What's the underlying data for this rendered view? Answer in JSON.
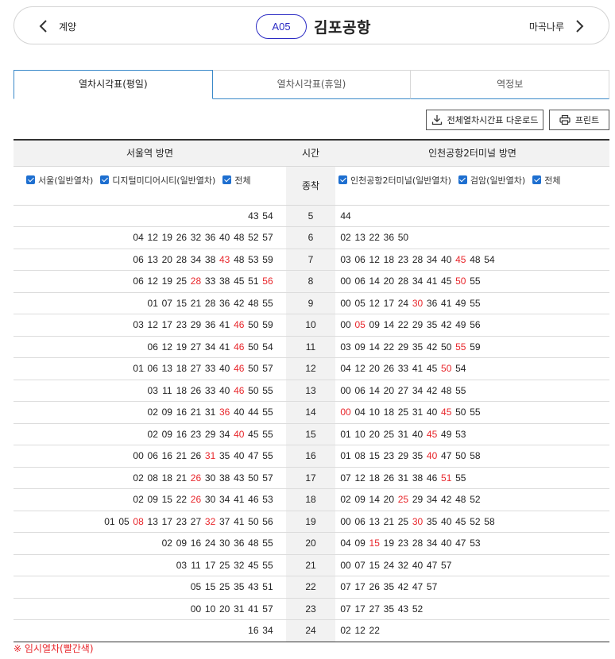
{
  "station": {
    "prev_label": "계양",
    "code": "A05",
    "name": "김포공항",
    "next_label": "마곡나루"
  },
  "tabs": [
    {
      "label": "열차시각표(평일)",
      "active": true
    },
    {
      "label": "열차시각표(휴일)",
      "active": false
    },
    {
      "label": "역정보",
      "active": false
    }
  ],
  "actions": {
    "download_label": "전체열차시간표 다운로드",
    "print_label": "프린트"
  },
  "timetable": {
    "header_left": "서울역 방면",
    "header_time": "시간",
    "header_right": "인천공항2터미널 방면",
    "terminal_label": "종착",
    "filters_left": [
      "서울(일반열차)",
      "디지털미디어시티(일반열차)",
      "전체"
    ],
    "filters_right": [
      "인천공항2터미널(일반열차)",
      "검암(일반열차)",
      "전체"
    ],
    "rows": [
      {
        "hour": "5",
        "left": [
          "43",
          "54"
        ],
        "right": [
          "44"
        ]
      },
      {
        "hour": "6",
        "left": [
          "04",
          "12",
          "19",
          "26",
          "32",
          "36",
          "40",
          "48",
          "52",
          "57"
        ],
        "right": [
          "02",
          "13",
          "22",
          "36",
          "50"
        ]
      },
      {
        "hour": "7",
        "left": [
          "06",
          "13",
          "20",
          "28",
          "34",
          "38",
          "*43",
          "48",
          "53",
          "59"
        ],
        "right": [
          "03",
          "06",
          "12",
          "18",
          "23",
          "28",
          "34",
          "40",
          "*45",
          "48",
          "54"
        ]
      },
      {
        "hour": "8",
        "left": [
          "06",
          "12",
          "19",
          "25",
          "*28",
          "33",
          "38",
          "45",
          "51",
          "*56"
        ],
        "right": [
          "00",
          "06",
          "14",
          "20",
          "28",
          "34",
          "41",
          "45",
          "*50",
          "55"
        ]
      },
      {
        "hour": "9",
        "left": [
          "01",
          "07",
          "15",
          "21",
          "28",
          "36",
          "42",
          "48",
          "55"
        ],
        "right": [
          "00",
          "05",
          "12",
          "17",
          "24",
          "*30",
          "36",
          "41",
          "49",
          "55"
        ]
      },
      {
        "hour": "10",
        "left": [
          "03",
          "12",
          "17",
          "23",
          "29",
          "36",
          "41",
          "*46",
          "50",
          "59"
        ],
        "right": [
          "00",
          "*05",
          "09",
          "14",
          "22",
          "29",
          "35",
          "42",
          "49",
          "56"
        ]
      },
      {
        "hour": "11",
        "left": [
          "06",
          "12",
          "19",
          "27",
          "34",
          "41",
          "*46",
          "50",
          "54"
        ],
        "right": [
          "03",
          "09",
          "14",
          "22",
          "29",
          "35",
          "42",
          "50",
          "*55",
          "59"
        ]
      },
      {
        "hour": "12",
        "left": [
          "01",
          "06",
          "13",
          "18",
          "27",
          "33",
          "40",
          "*46",
          "50",
          "57"
        ],
        "right": [
          "04",
          "12",
          "20",
          "26",
          "33",
          "41",
          "45",
          "*50",
          "54"
        ]
      },
      {
        "hour": "13",
        "left": [
          "03",
          "11",
          "18",
          "26",
          "33",
          "40",
          "*46",
          "50",
          "55"
        ],
        "right": [
          "00",
          "06",
          "14",
          "20",
          "27",
          "34",
          "42",
          "48",
          "55"
        ]
      },
      {
        "hour": "14",
        "left": [
          "02",
          "09",
          "16",
          "21",
          "31",
          "*36",
          "40",
          "44",
          "55"
        ],
        "right": [
          "*00",
          "04",
          "10",
          "18",
          "25",
          "31",
          "40",
          "*45",
          "50",
          "55"
        ]
      },
      {
        "hour": "15",
        "left": [
          "02",
          "09",
          "16",
          "23",
          "29",
          "34",
          "*40",
          "45",
          "55"
        ],
        "right": [
          "01",
          "10",
          "20",
          "25",
          "31",
          "40",
          "*45",
          "49",
          "53"
        ]
      },
      {
        "hour": "16",
        "left": [
          "00",
          "06",
          "16",
          "21",
          "26",
          "*31",
          "35",
          "40",
          "47",
          "55"
        ],
        "right": [
          "01",
          "08",
          "15",
          "23",
          "29",
          "35",
          "*40",
          "47",
          "50",
          "58"
        ]
      },
      {
        "hour": "17",
        "left": [
          "02",
          "08",
          "18",
          "21",
          "*26",
          "30",
          "38",
          "43",
          "50",
          "57"
        ],
        "right": [
          "07",
          "12",
          "18",
          "26",
          "31",
          "38",
          "46",
          "*51",
          "55"
        ]
      },
      {
        "hour": "18",
        "left": [
          "02",
          "09",
          "15",
          "22",
          "*26",
          "30",
          "34",
          "41",
          "46",
          "53"
        ],
        "right": [
          "02",
          "09",
          "14",
          "20",
          "*25",
          "29",
          "34",
          "42",
          "48",
          "52"
        ]
      },
      {
        "hour": "19",
        "left": [
          "01",
          "05",
          "*08",
          "13",
          "17",
          "23",
          "27",
          "*32",
          "37",
          "41",
          "50",
          "56"
        ],
        "right": [
          "00",
          "06",
          "13",
          "21",
          "25",
          "*30",
          "35",
          "40",
          "45",
          "52",
          "58"
        ]
      },
      {
        "hour": "20",
        "left": [
          "02",
          "09",
          "16",
          "24",
          "30",
          "36",
          "48",
          "55"
        ],
        "right": [
          "04",
          "09",
          "*15",
          "19",
          "23",
          "28",
          "34",
          "40",
          "47",
          "53"
        ]
      },
      {
        "hour": "21",
        "left": [
          "03",
          "11",
          "17",
          "25",
          "32",
          "45",
          "55"
        ],
        "right": [
          "00",
          "07",
          "15",
          "24",
          "32",
          "40",
          "47",
          "57"
        ]
      },
      {
        "hour": "22",
        "left": [
          "05",
          "15",
          "25",
          "35",
          "43",
          "51"
        ],
        "right": [
          "07",
          "17",
          "26",
          "35",
          "42",
          "47",
          "57"
        ]
      },
      {
        "hour": "23",
        "left": [
          "00",
          "10",
          "20",
          "31",
          "41",
          "57"
        ],
        "right": [
          "07",
          "17",
          "27",
          "35",
          "43",
          "52"
        ]
      },
      {
        "hour": "24",
        "left": [
          "16",
          "34"
        ],
        "right": [
          "02",
          "12",
          "22"
        ]
      }
    ]
  },
  "note": "※ 임시열차(빨간색)",
  "colors": {
    "accent_blue": "#2b2bc4",
    "tab_border": "#3a89c9",
    "checkbox": "#1e6fd0",
    "extra_train_red": "#e8262b"
  }
}
